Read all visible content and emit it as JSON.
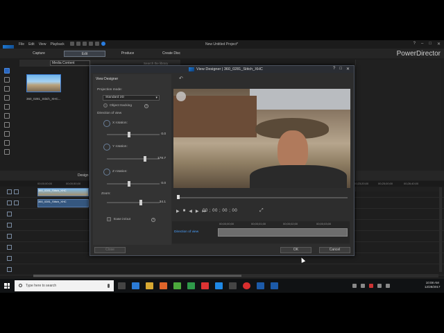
{
  "app": {
    "menu": [
      "File",
      "Edit",
      "View",
      "Playback"
    ],
    "project_title": "New Untitled Project*",
    "brand": "PowerDirector",
    "window_controls": [
      "?",
      "–",
      "□",
      "✕"
    ]
  },
  "tabs": [
    {
      "label": "Capture",
      "active": false
    },
    {
      "label": "Edit",
      "active": true
    },
    {
      "label": "Produce",
      "active": false
    },
    {
      "label": "Create Disc",
      "active": false
    }
  ],
  "media": {
    "filter": "Media Content",
    "search_placeholder": "Search the library",
    "clip_name": "360_0281_Stitch_XHC..."
  },
  "timeline": {
    "toolbar_label": "Design",
    "ruler": [
      "00;00;00;00",
      "00;00;50;00",
      "00;23;20;00",
      "00;25;00;00",
      "00;26;40;00"
    ],
    "video_clip": "360_0281_Stitch_XHC",
    "audio_clip": "360_0281_Stitch_XHC"
  },
  "dialog": {
    "title": "View Designer  |  360_0281_Stitch_XHC",
    "panel_title": "View Designer",
    "projection_label": "Projection mode:",
    "projection_value": "Standard 2D",
    "object_tracking": "Object tracking",
    "direction_label": "Direction of view",
    "x_rotation": {
      "label": "X rotation:",
      "value": "0.0",
      "position": 0.42
    },
    "y_rotation": {
      "label": "Y rotation:",
      "value": "178.7",
      "position": 0.72
    },
    "z_rotation": {
      "label": "Z rotation:",
      "value": "0.0",
      "position": 0.42
    },
    "zoom": {
      "label": "Zoom:",
      "value": "34.1",
      "position": 0.64
    },
    "ease": "Ease in/out",
    "timecode": "00 ; 00 ; 00 ; 00",
    "ruler": [
      "00;00;00;00",
      "00;00;01;00",
      "00;00;02;00",
      "00;00;03;00"
    ],
    "track_label": "Direction of view",
    "buttons": {
      "close": "Close",
      "ok": "OK",
      "cancel": "Cancel"
    }
  },
  "taskbar": {
    "search_placeholder": "Type here to search",
    "time": "10:08 AM",
    "date": "12/28/2017"
  }
}
